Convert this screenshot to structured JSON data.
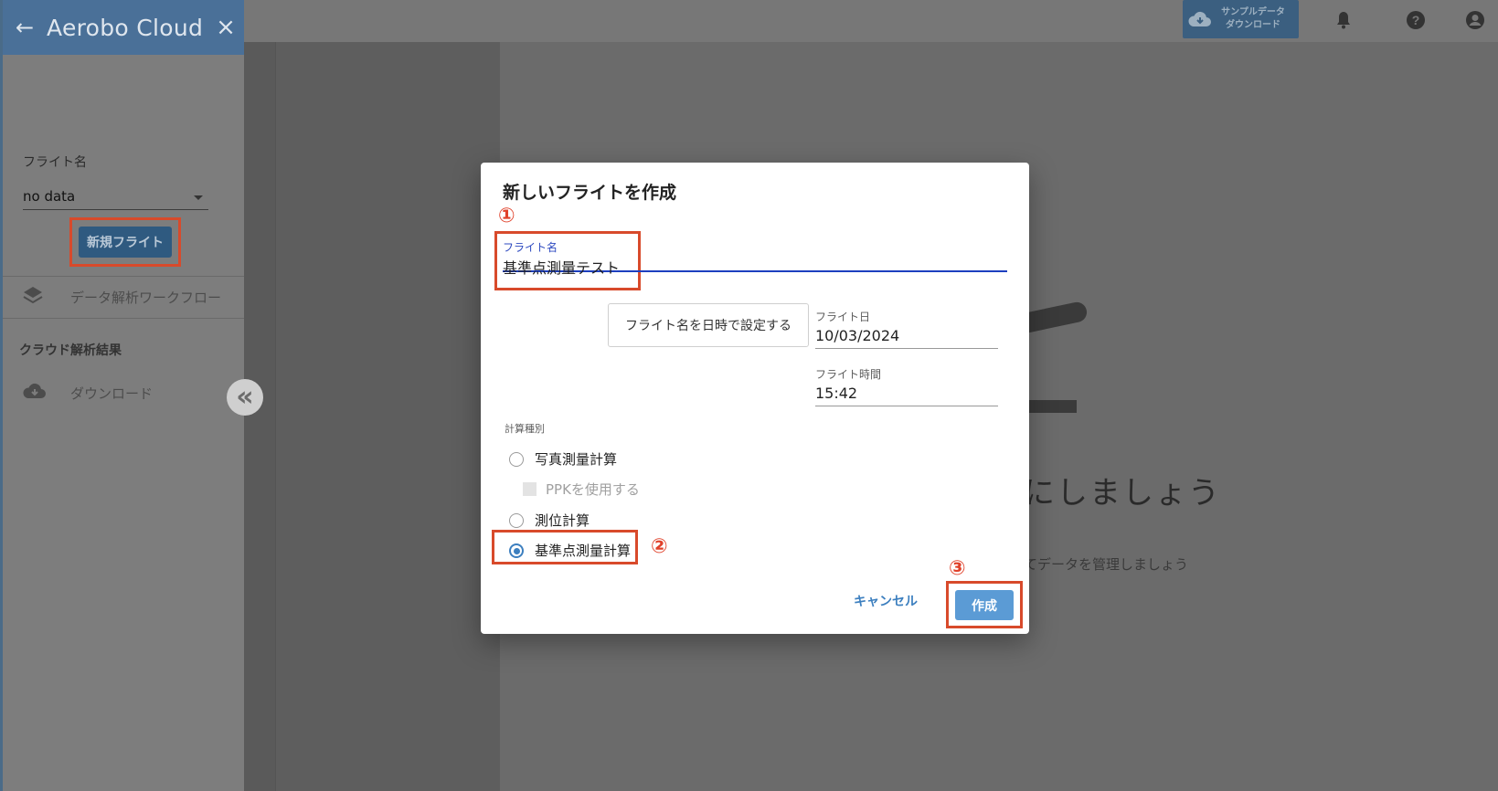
{
  "topbar": {
    "sample_button_line1": "サンプルデータ",
    "sample_button_line2": "ダウンロード"
  },
  "drawer": {
    "app_title": "Aerobo Cloud",
    "flight_name_label": "フライト名",
    "flight_select_value": "no data",
    "new_flight_button": "新規フライト",
    "workflow_item": "データ解析ワークフロー",
    "cloud_results_heading": "クラウド解析結果",
    "download_item": "ダウンロード"
  },
  "background": {
    "heading_fragment": "にしましょう",
    "sub_fragment": "てデータを管理しましょう"
  },
  "dialog": {
    "title": "新しいフライトを作成",
    "flight_name_label": "フライト名",
    "flight_name_value": "基準点測量テスト",
    "set_name_from_datetime_button": "フライト名を日時で設定する",
    "flight_date_label": "フライト日",
    "flight_date_value": "10/03/2024",
    "flight_time_label": "フライト時間",
    "flight_time_value": "15:42",
    "calc_type_label": "計算種別",
    "options": {
      "photo_survey": "写真測量計算",
      "use_ppk": "PPKを使用する",
      "positioning": "測位計算",
      "control_point_survey": "基準点測量計算"
    },
    "selected_option": "基準点測量計算",
    "cancel_button": "キャンセル",
    "create_button": "作成"
  },
  "annotations": {
    "step1": "①",
    "step2": "②",
    "step3": "③",
    "color": "#d84a2b"
  }
}
